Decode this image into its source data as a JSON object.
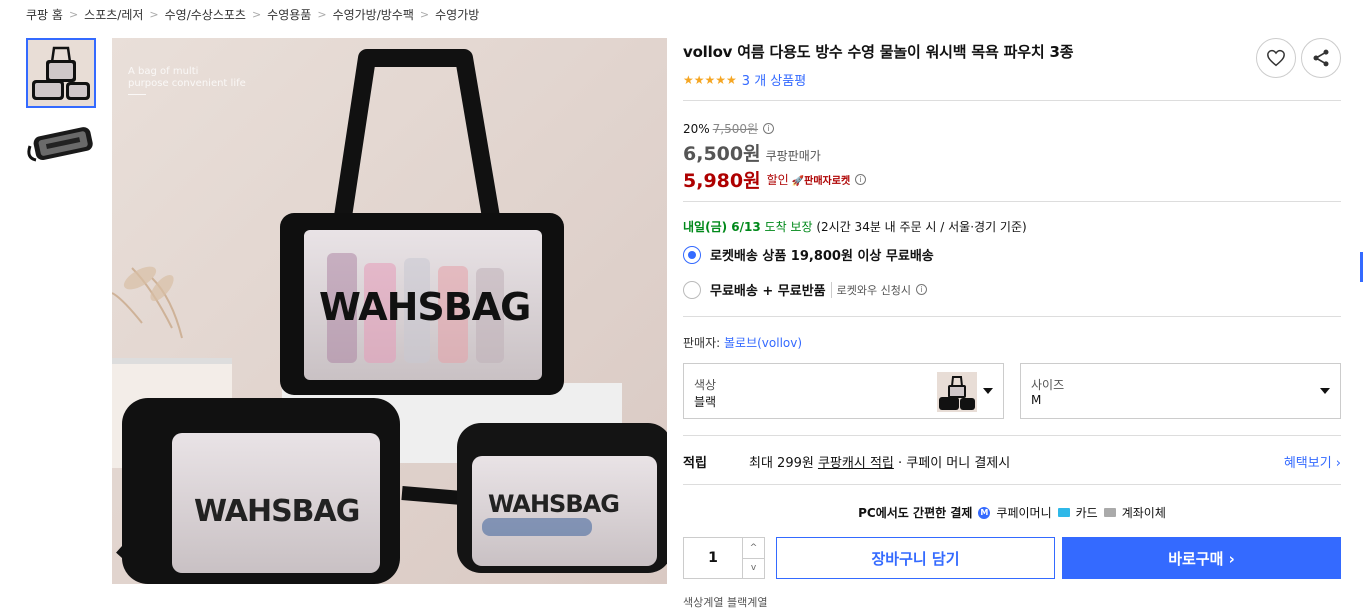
{
  "breadcrumb": [
    "쿠팡 홈",
    "스포츠/레저",
    "수영/수상스포츠",
    "수영용품",
    "수영가방/방수팩",
    "수영가방"
  ],
  "breadcrumb_sep": ">",
  "product": {
    "title": "vollov 여름 다용도 방수 수영 물놀이 워시백 목욕 파우치 3종",
    "stars": "★★★★★",
    "review_text": "3 개 상품평"
  },
  "image_text": {
    "overlay": "A bag of multi purpose convenient life",
    "overlay_line1": "A bag of multi",
    "overlay_line2": "purpose convenient life",
    "bag_brand": "WAHSBAG"
  },
  "price": {
    "discount_rate": "20%",
    "original": "7,500원",
    "sale": "6,500원",
    "sale_label": "쿠팡판매가",
    "final": "5,980원",
    "final_label": "할인",
    "rocket_badge": "🚀판매자로켓"
  },
  "delivery": {
    "arrival_day": "내일(금) 6/13",
    "arrival_suffix": "도착 보장",
    "arrival_note": "(2시간 34분 내 주문 시 / 서울·경기 기준)",
    "option1": "로켓배송 상품 19,800원 이상 무료배송",
    "option2": "무료배송 + 무료반품",
    "option2_sub": "로켓와우 신청시"
  },
  "seller": {
    "label": "판매자:",
    "name": "볼로브(vollov)"
  },
  "options": {
    "color_label": "색상",
    "color_value": "블랙",
    "size_label": "사이즈",
    "size_value": "M"
  },
  "points": {
    "label": "적립",
    "max": "최대 299원",
    "cash": "쿠팡캐시 적립",
    "rest": "· 쿠페이 머니 결제시",
    "benefit": "혜택보기 ›"
  },
  "payment": {
    "intro": "PC에서도 간편한 결제",
    "pm_icon": "M",
    "money": "쿠페이머니",
    "card": "카드",
    "bank": "계좌이체"
  },
  "purchase": {
    "quantity": "1",
    "up": "^",
    "down": "v",
    "cart": "장바구니 담기",
    "buy": "바로구매 ›"
  },
  "cut_text": "색상계열 블랙계열",
  "colors": {
    "accent": "#346aff",
    "price_red": "#ae0000",
    "arrival_green": "#00891a",
    "star": "#f5a623"
  },
  "icons": [
    "heart-icon",
    "share-icon",
    "info-icon",
    "radio-checked",
    "radio-unchecked",
    "caret-down-icon"
  ]
}
